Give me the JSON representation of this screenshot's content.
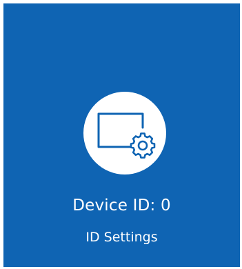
{
  "tile": {
    "title": "Device ID: 0",
    "subtitle": "ID Settings",
    "icon": "display-gear-icon",
    "background_color": "#0f64b3"
  }
}
